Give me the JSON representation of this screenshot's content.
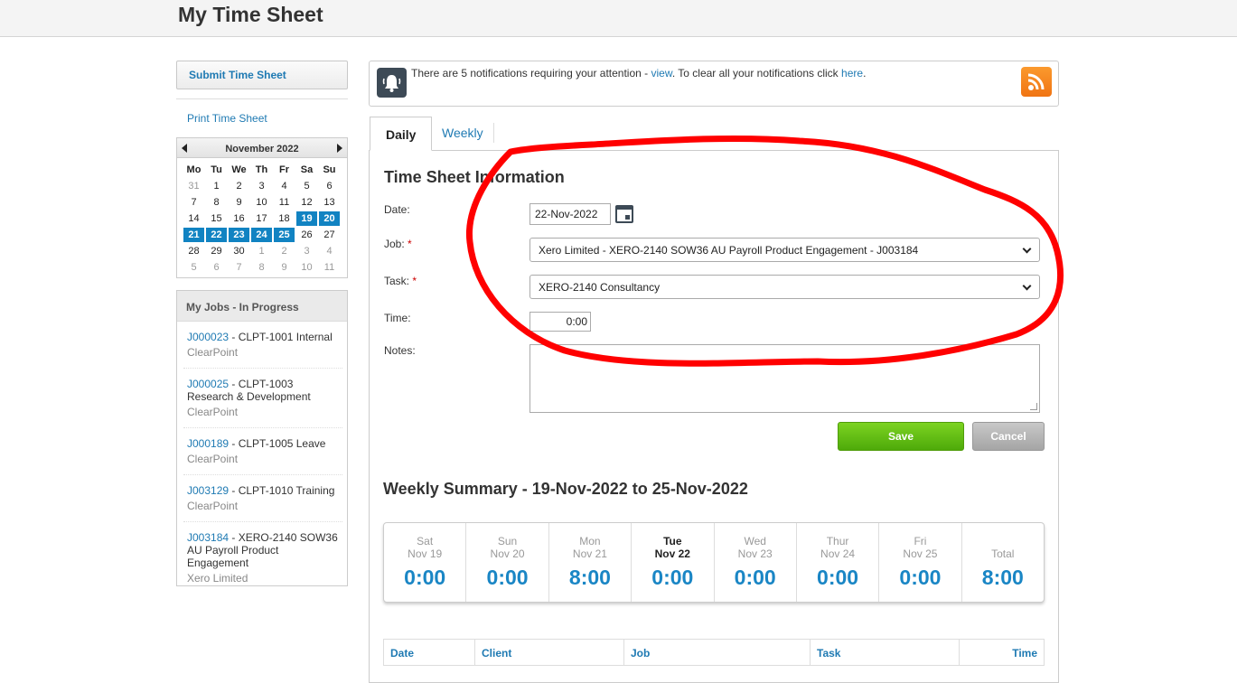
{
  "page": {
    "title": "My Time Sheet"
  },
  "sidebar": {
    "submit_label": "Submit Time Sheet",
    "print_label": "Print Time Sheet",
    "calendar": {
      "month": "November 2022",
      "weekdays": [
        "Mo",
        "Tu",
        "We",
        "Th",
        "Fr",
        "Sa",
        "Su"
      ],
      "weeks": [
        [
          {
            "d": "31",
            "o": true
          },
          {
            "d": "1"
          },
          {
            "d": "2"
          },
          {
            "d": "3"
          },
          {
            "d": "4"
          },
          {
            "d": "5"
          },
          {
            "d": "6"
          }
        ],
        [
          {
            "d": "7"
          },
          {
            "d": "8"
          },
          {
            "d": "9"
          },
          {
            "d": "10"
          },
          {
            "d": "11"
          },
          {
            "d": "12"
          },
          {
            "d": "13"
          }
        ],
        [
          {
            "d": "14"
          },
          {
            "d": "15"
          },
          {
            "d": "16"
          },
          {
            "d": "17"
          },
          {
            "d": "18"
          },
          {
            "d": "19",
            "s": true
          },
          {
            "d": "20",
            "s": true
          }
        ],
        [
          {
            "d": "21",
            "s": true
          },
          {
            "d": "22",
            "s": true
          },
          {
            "d": "23",
            "s": true
          },
          {
            "d": "24",
            "s": true
          },
          {
            "d": "25",
            "s": true
          },
          {
            "d": "26"
          },
          {
            "d": "27"
          }
        ],
        [
          {
            "d": "28"
          },
          {
            "d": "29"
          },
          {
            "d": "30"
          },
          {
            "d": "1",
            "o": true
          },
          {
            "d": "2",
            "o": true
          },
          {
            "d": "3",
            "o": true
          },
          {
            "d": "4",
            "o": true
          }
        ],
        [
          {
            "d": "5",
            "o": true
          },
          {
            "d": "6",
            "o": true
          },
          {
            "d": "7",
            "o": true
          },
          {
            "d": "8",
            "o": true
          },
          {
            "d": "9",
            "o": true
          },
          {
            "d": "10",
            "o": true
          },
          {
            "d": "11",
            "o": true
          }
        ]
      ]
    },
    "jobs_heading": "My Jobs - In Progress",
    "jobs": [
      {
        "code": "J000023",
        "name": " - CLPT-1001 Internal",
        "client": "ClearPoint"
      },
      {
        "code": "J000025",
        "name": " - CLPT-1003 Research & Development",
        "client": "ClearPoint"
      },
      {
        "code": "J000189",
        "name": " - CLPT-1005 Leave",
        "client": "ClearPoint"
      },
      {
        "code": "J003129",
        "name": " - CLPT-1010 Training",
        "client": "ClearPoint"
      },
      {
        "code": "J003184",
        "name": " - XERO-2140 SOW36 AU Payroll Product Engagement",
        "client": "Xero Limited"
      }
    ]
  },
  "notification": {
    "text_before": "There are 5 notifications requiring your attention - ",
    "view_link": "view",
    "text_middle": ". To clear all your notifications click ",
    "here_link": "here",
    "text_after": "."
  },
  "tabs": {
    "daily": "Daily",
    "weekly": "Weekly"
  },
  "form": {
    "section_title": "Time Sheet Information",
    "date_label": "Date:",
    "date_value": "22-Nov-2022",
    "job_label": "Job:",
    "job_value": "Xero Limited - XERO-2140 SOW36 AU Payroll Product Engagement - J003184",
    "task_label": "Task:",
    "task_value": "XERO-2140 Consultancy",
    "time_label": "Time:",
    "time_value": "0:00",
    "notes_label": "Notes:",
    "notes_value": "",
    "required_mark": "*",
    "save_label": "Save",
    "cancel_label": "Cancel"
  },
  "weekly_summary": {
    "title": "Weekly Summary - 19-Nov-2022 to 25-Nov-2022",
    "days": [
      {
        "day": "Sat",
        "date": "Nov 19",
        "time": "0:00"
      },
      {
        "day": "Sun",
        "date": "Nov 20",
        "time": "0:00"
      },
      {
        "day": "Mon",
        "date": "Nov 21",
        "time": "8:00"
      },
      {
        "day": "Tue",
        "date": "Nov 22",
        "time": "0:00",
        "today": true
      },
      {
        "day": "Wed",
        "date": "Nov 23",
        "time": "0:00"
      },
      {
        "day": "Thur",
        "date": "Nov 24",
        "time": "0:00"
      },
      {
        "day": "Fri",
        "date": "Nov 25",
        "time": "0:00"
      },
      {
        "day": "",
        "date": "Total",
        "time": "8:00"
      }
    ]
  },
  "entries_table": {
    "columns": [
      "Date",
      "Client",
      "Job",
      "Task",
      "Time"
    ]
  },
  "colors": {
    "link": "#1f7ab3",
    "accent": "#1183c2",
    "save": "#5cb811",
    "annotation": "#ff0000"
  }
}
